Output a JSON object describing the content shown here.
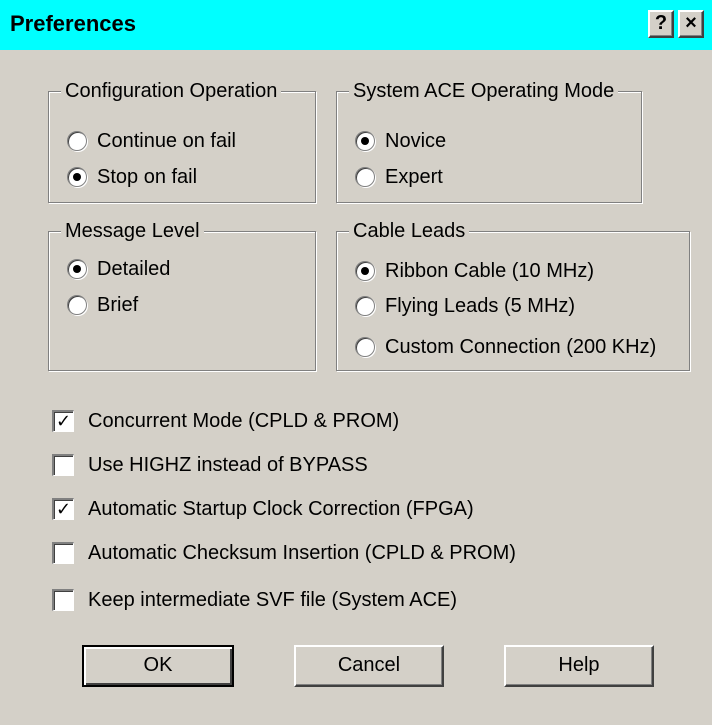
{
  "window": {
    "title": "Preferences",
    "help_button": "?",
    "close_button": "×",
    "titlebar_color": "#00ffff",
    "face_color": "#d4d0c8"
  },
  "config_operation": {
    "legend": "Configuration Operation",
    "options": [
      {
        "label": "Continue on fail",
        "selected": false
      },
      {
        "label": "Stop on fail",
        "selected": true
      }
    ]
  },
  "system_ace_mode": {
    "legend": "System ACE Operating Mode",
    "options": [
      {
        "label": "Novice",
        "selected": true
      },
      {
        "label": "Expert",
        "selected": false
      }
    ]
  },
  "message_level": {
    "legend": "Message Level",
    "options": [
      {
        "label": "Detailed",
        "selected": true
      },
      {
        "label": "Brief",
        "selected": false
      }
    ]
  },
  "cable_leads": {
    "legend": "Cable Leads",
    "options": [
      {
        "label": "Ribbon Cable (10 MHz)",
        "selected": true
      },
      {
        "label": "Flying Leads (5 MHz)",
        "selected": false
      },
      {
        "label": "Custom Connection (200 KHz)",
        "selected": false
      }
    ]
  },
  "checkboxes": [
    {
      "label": "Concurrent Mode (CPLD & PROM)",
      "checked": true
    },
    {
      "label": "Use HIGHZ instead of BYPASS",
      "checked": false
    },
    {
      "label": "Automatic Startup Clock Correction (FPGA)",
      "checked": true
    },
    {
      "label": "Automatic Checksum Insertion (CPLD & PROM)",
      "checked": false
    },
    {
      "label": "Keep intermediate SVF file (System ACE)",
      "checked": false
    }
  ],
  "buttons": {
    "ok": "OK",
    "cancel": "Cancel",
    "help": "Help"
  }
}
